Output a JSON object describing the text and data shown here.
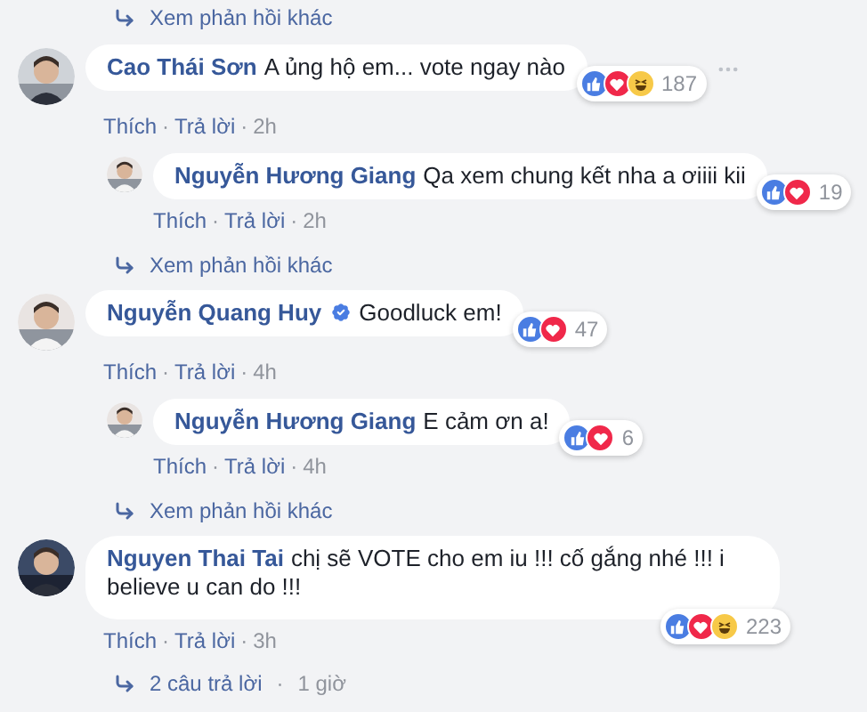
{
  "separator": "·",
  "top_link": {
    "text": "Xem phản hồi khác"
  },
  "comments": [
    {
      "name": "Cao Thái Sơn",
      "verified": false,
      "text": "A ủng hộ em... vote ngay nào",
      "reactions": [
        {
          "kind": "like"
        },
        {
          "kind": "love"
        },
        {
          "kind": "haha"
        }
      ],
      "reaction_count": "187",
      "show_options": true,
      "actions": [
        "Thích",
        "Trả lời"
      ],
      "time": "2h",
      "avatar": {
        "kind": "picture"
      },
      "replies": [
        {
          "name": "Nguyễn Hương Giang",
          "verified": false,
          "text": "Qa xem chung kết nha a ơiiii kii",
          "reactions": [
            {
              "kind": "like"
            },
            {
              "kind": "love"
            }
          ],
          "reaction_count": "19",
          "actions": [
            "Thích",
            "Trả lời"
          ],
          "time": "2h",
          "avatar": {
            "kind": "picture"
          }
        }
      ],
      "more_link": {
        "text": "Xem phản hồi khác"
      }
    },
    {
      "name": "Nguyễn Quang Huy",
      "verified": true,
      "text": "Goodluck em!",
      "reactions": [
        {
          "kind": "like"
        },
        {
          "kind": "love"
        }
      ],
      "reaction_count": "47",
      "show_options": false,
      "actions": [
        "Thích",
        "Trả lời"
      ],
      "time": "4h",
      "avatar": {
        "kind": "picture"
      },
      "replies": [
        {
          "name": "Nguyễn Hương Giang",
          "verified": false,
          "text": "E cảm ơn a!",
          "reactions": [
            {
              "kind": "like"
            },
            {
              "kind": "love"
            }
          ],
          "reaction_count": "6",
          "actions": [
            "Thích",
            "Trả lời"
          ],
          "time": "4h",
          "avatar": {
            "kind": "picture"
          }
        }
      ],
      "more_link": {
        "text": "Xem phản hồi khác"
      }
    },
    {
      "name": "Nguyen Thai Tai",
      "verified": false,
      "text": "chị sẽ VOTE cho em iu !!! cố gắng nhé !!! i believe u can do !!!",
      "reactions": [
        {
          "kind": "like"
        },
        {
          "kind": "love"
        },
        {
          "kind": "haha"
        }
      ],
      "reaction_count": "223",
      "show_options": false,
      "actions": [
        "Thích",
        "Trả lời"
      ],
      "time": "3h",
      "avatar": {
        "kind": "picture"
      },
      "more_link": {
        "text": "2 câu trả lời",
        "time": "1 giờ"
      }
    }
  ]
}
